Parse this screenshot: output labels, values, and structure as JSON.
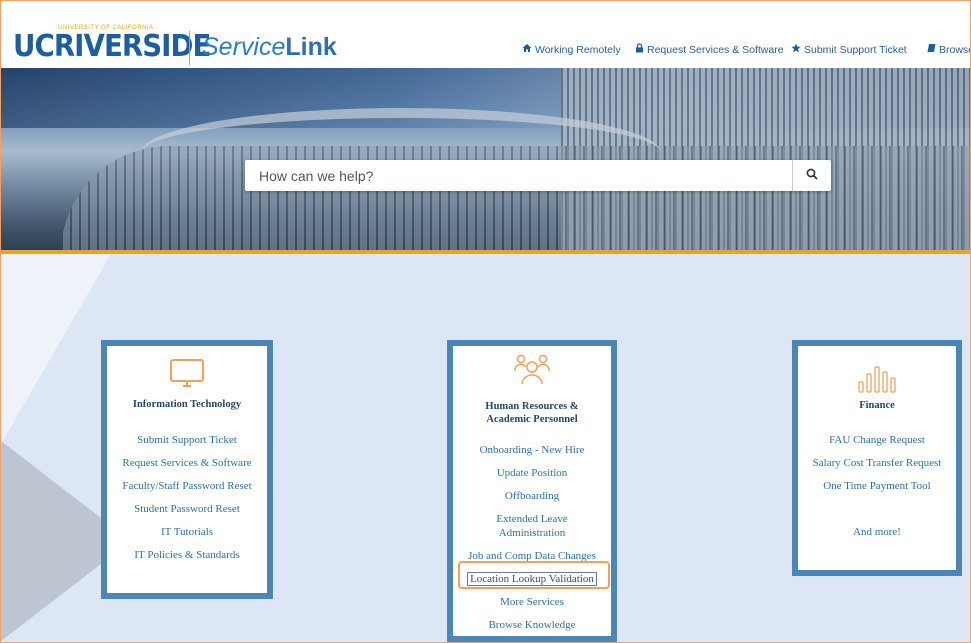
{
  "header": {
    "logo_univ": "UNIVERSITY OF CALIFORNIA",
    "logo_uc": "UC",
    "logo_riverside": "RIVERSIDE",
    "logo_service": "Service",
    "logo_link": "Link",
    "nav": [
      {
        "label": "Working Remotely",
        "icon": "home-icon"
      },
      {
        "label": "Request Services & Software",
        "icon": "lock-icon"
      },
      {
        "label": "Submit Support Ticket",
        "icon": "star-icon"
      },
      {
        "label": "Browse",
        "icon": "book-icon"
      }
    ]
  },
  "search": {
    "placeholder": "How can we help?",
    "button_icon": "search-icon"
  },
  "cards": {
    "it": {
      "icon": "monitor-icon",
      "title": "Information Technology",
      "links": [
        "Submit Support Ticket",
        "Request Services & Software",
        "Faculty/Staff Password Reset",
        "Student Password Reset",
        "IT Tutorials",
        "IT Policies & Standards"
      ]
    },
    "hr": {
      "icon": "people-icon",
      "title_line1": "Human Resources &",
      "title_line2": "Academic Personnel",
      "links": [
        "Onboarding - New Hire",
        "Update Position",
        "Offboarding",
        "Extended Leave",
        "Administration",
        "Job and Comp Data Changes",
        "Location Lookup Validation",
        "More Services",
        "Browse Knowledge"
      ]
    },
    "finance": {
      "icon": "bar-chart-icon",
      "title": "Finance",
      "links": [
        "FAU Change Request",
        "Salary Cost Transfer Request",
        "One Time Payment Tool",
        "And more!"
      ]
    }
  },
  "colors": {
    "accent_orange": "#f0a15c",
    "card_border": "#4a86b6",
    "link": "#2e6ea8",
    "gold": "#e5a52b"
  }
}
